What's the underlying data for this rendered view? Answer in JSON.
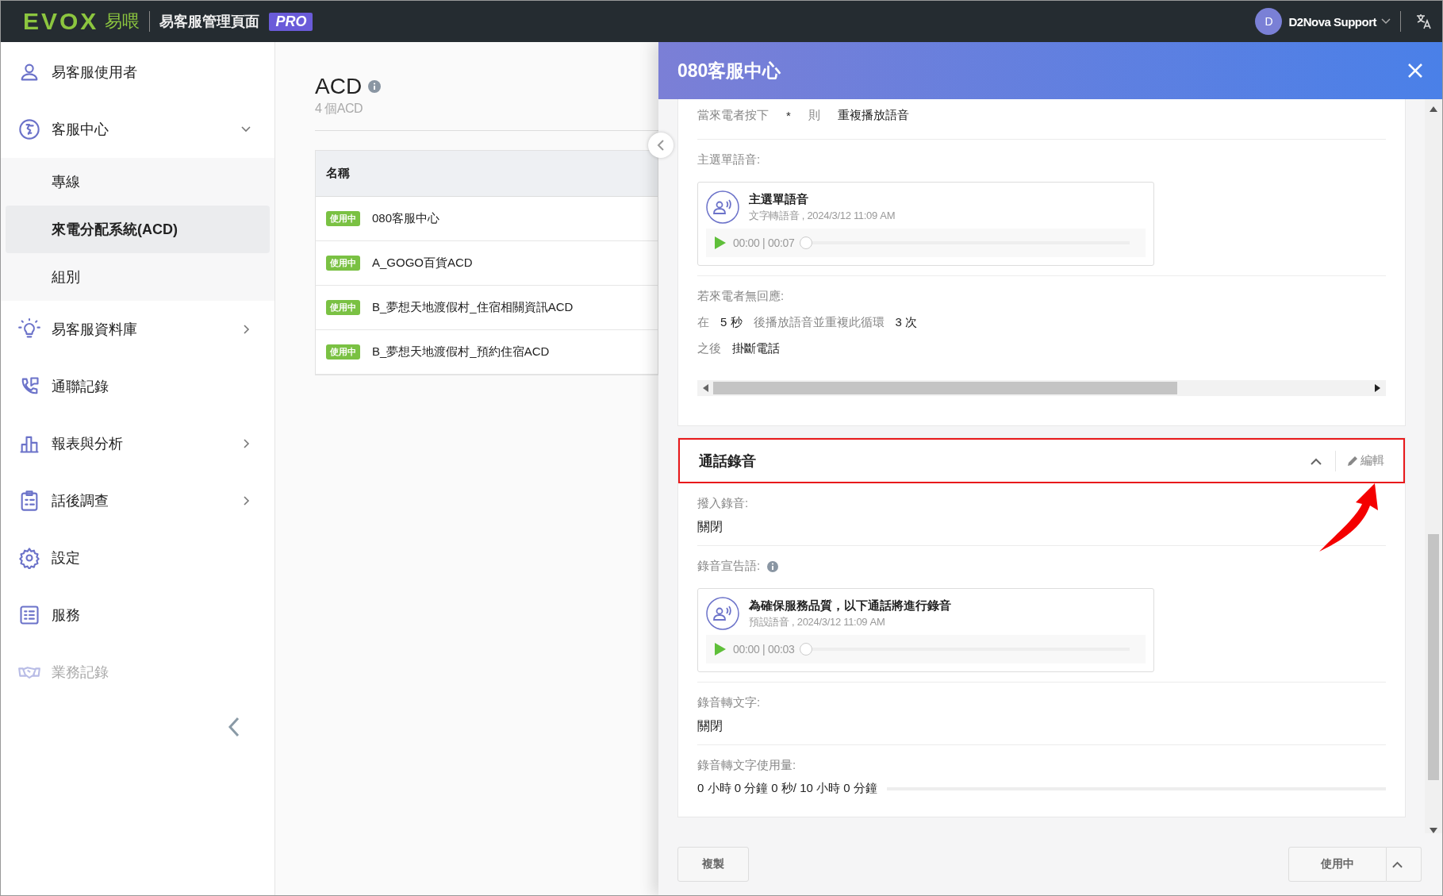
{
  "top_bar": {
    "logo": "EVOX",
    "logo_cn": "易喂",
    "app_title": "易客服管理頁面",
    "badge": "PRO",
    "user": {
      "initial": "D",
      "name": "D2Nova Support"
    }
  },
  "sidebar": {
    "items": [
      {
        "label": "易客服使用者",
        "disabled": false
      },
      {
        "label": "客服中心",
        "disabled": false,
        "expanded": true,
        "children": [
          {
            "label": "專線",
            "selected": false
          },
          {
            "label": "來電分配系統(ACD)",
            "selected": true
          },
          {
            "label": "組別",
            "selected": false
          }
        ]
      },
      {
        "label": "易客服資料庫",
        "disabled": false,
        "expanded": false
      },
      {
        "label": "通聯記錄",
        "disabled": false
      },
      {
        "label": "報表與分析",
        "disabled": false,
        "expanded": false
      },
      {
        "label": "話後調查",
        "disabled": false,
        "expanded": false
      },
      {
        "label": "設定",
        "disabled": false
      },
      {
        "label": "服務",
        "disabled": false
      },
      {
        "label": "業務記錄",
        "disabled": true
      }
    ]
  },
  "list": {
    "title": "ACD",
    "subtitle": "4 個ACD",
    "columns": [
      "名稱"
    ],
    "rows": [
      {
        "status": "使用中",
        "name": "080客服中心"
      },
      {
        "status": "使用中",
        "name": "A_GOGO百貨ACD"
      },
      {
        "status": "使用中",
        "name": "B_夢想天地渡假村_住宿相關資訊ACD"
      },
      {
        "status": "使用中",
        "name": "B_夢想天地渡假村_預約住宿ACD"
      }
    ]
  },
  "panel": {
    "title": "080客服中心",
    "top_card": {
      "fields": [
        {
          "kind": "keypress",
          "label": "當來電者按下",
          "key": "*",
          "then": "則",
          "action": "重複播放語音"
        },
        {
          "kind": "audio",
          "label": "主選單語音:",
          "title": "主選單語音",
          "meta": "文字轉語音 , 2024/3/12 11:09 AM",
          "time": "00:00 | 00:07",
          "level": 0
        },
        {
          "kind": "timeout",
          "label": "若來電者無回應:",
          "lines": [
            [
              {
                "kind": "label",
                "text": "在"
              },
              {
                "kind": "value",
                "text": "5 秒"
              },
              {
                "kind": "label",
                "text": "後播放語音並重複此循環"
              },
              {
                "kind": "value",
                "text": "3 次"
              }
            ],
            [
              {
                "kind": "label",
                "text": "之後"
              },
              {
                "kind": "value",
                "text": "掛斷電話"
              }
            ]
          ]
        }
      ]
    },
    "section": {
      "title": "通話錄音",
      "expanded": true,
      "highlighted": true,
      "edit": "編輯",
      "fields": [
        {
          "kind": "text",
          "label": "撥入錄音:",
          "value": "關閉"
        },
        {
          "kind": "audio",
          "label": "錄音宣告語:",
          "info": true,
          "title": "為確保服務品質，以下通話將進行錄音",
          "meta": "預設語音 , 2024/3/12 11:09 AM",
          "time": "00:00 | 00:03",
          "level": 0
        },
        {
          "kind": "text",
          "label": "錄音轉文字:",
          "value": "關閉"
        },
        {
          "kind": "usage",
          "label": "錄音轉文字使用量:",
          "value": "0 小時 0 分鐘 0 秒/ 10 小時 0 分鐘",
          "level": 0
        }
      ]
    },
    "footer": {
      "copy": "複製",
      "status": "使用中"
    }
  }
}
